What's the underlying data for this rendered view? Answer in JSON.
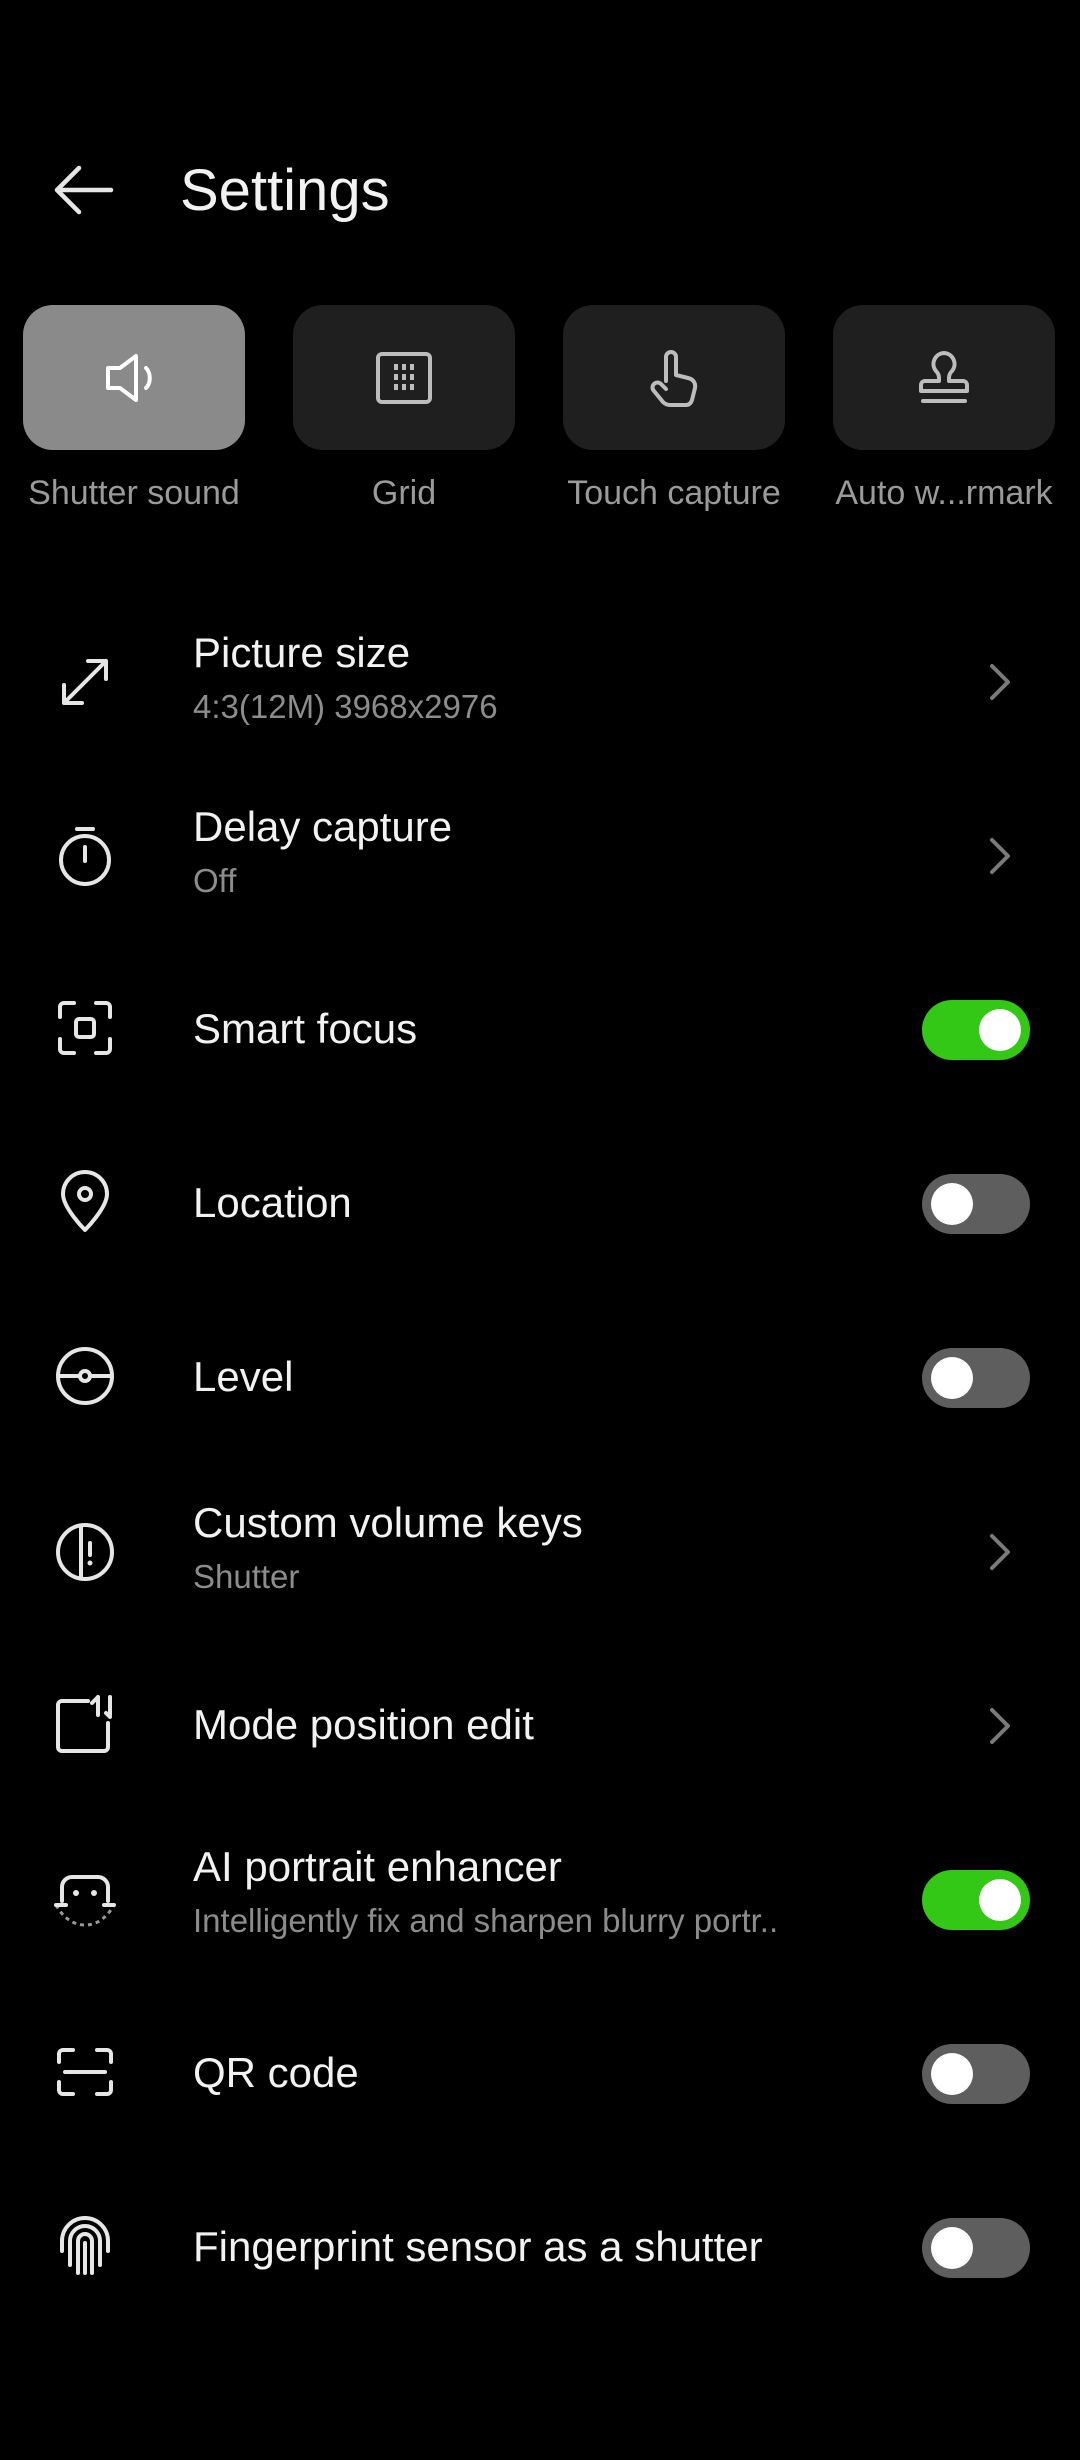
{
  "header": {
    "title": "Settings",
    "back_icon": "arrow-left-icon"
  },
  "quick_settings": [
    {
      "label": "Shutter sound",
      "icon": "speaker-icon",
      "active": true
    },
    {
      "label": "Grid",
      "icon": "grid-icon",
      "active": false
    },
    {
      "label": "Touch capture",
      "icon": "hand-pointer-icon",
      "active": false
    },
    {
      "label": "Auto w...rmark",
      "icon": "stamp-icon",
      "active": false
    }
  ],
  "settings": [
    {
      "label": "Picture size",
      "value": "4:3(12M) 3968x2976",
      "icon": "resize-icon",
      "control": "chevron"
    },
    {
      "label": "Delay capture",
      "value": "Off",
      "icon": "timer-icon",
      "control": "chevron"
    },
    {
      "label": "Smart focus",
      "icon": "focus-frame-icon",
      "control": "toggle",
      "on": true
    },
    {
      "label": "Location",
      "icon": "location-pin-icon",
      "control": "toggle",
      "on": false
    },
    {
      "label": "Level",
      "icon": "level-icon",
      "control": "toggle",
      "on": false
    },
    {
      "label": "Custom volume keys",
      "value": "Shutter",
      "icon": "volume-key-icon",
      "control": "chevron"
    },
    {
      "label": "Mode position edit",
      "icon": "mode-edit-icon",
      "control": "chevron"
    },
    {
      "label": "AI portrait enhancer",
      "value": "Intelligently fix and sharpen blurry portr..",
      "icon": "ai-portrait-icon",
      "control": "toggle",
      "on": true
    },
    {
      "label": "QR code",
      "icon": "qr-scan-icon",
      "control": "toggle",
      "on": false
    },
    {
      "label": "Fingerprint sensor as a shutter",
      "icon": "fingerprint-icon",
      "control": "toggle",
      "on": false
    }
  ],
  "colors": {
    "toggle_on": "#34c816",
    "toggle_off": "#5e5e5e",
    "tile_active": "#8a8a8a",
    "tile_inactive": "#1f1f1f"
  }
}
